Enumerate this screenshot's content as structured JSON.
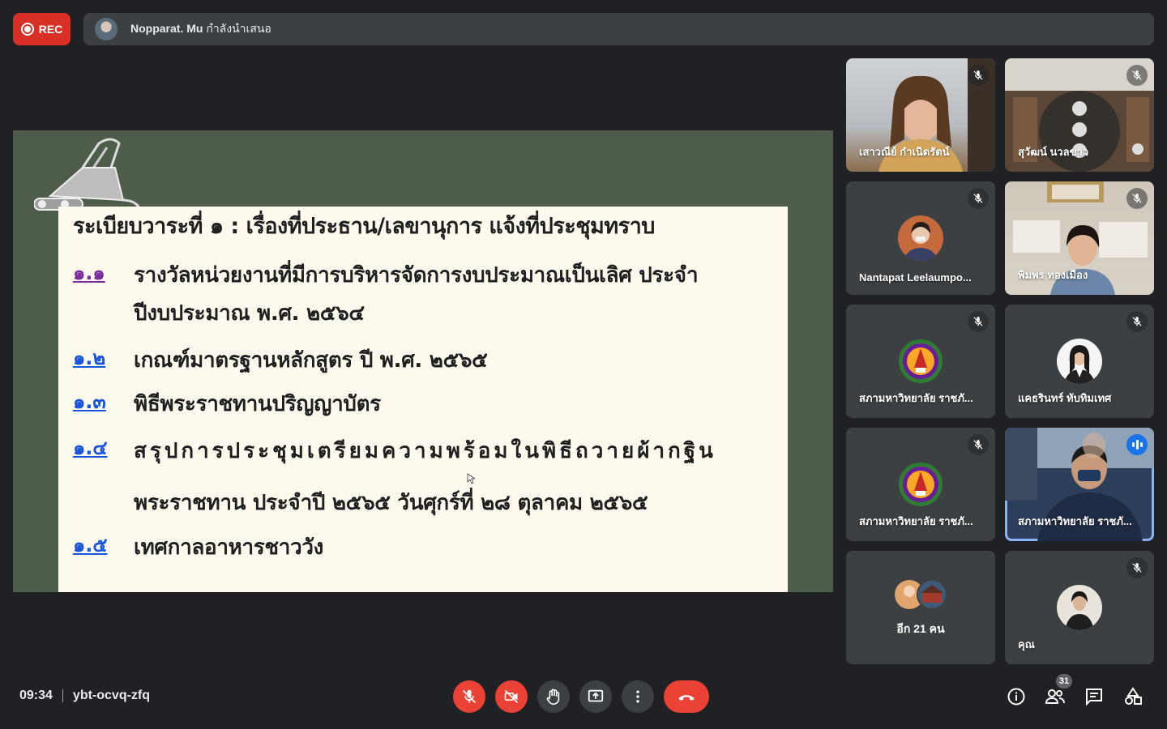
{
  "recording": {
    "label": "REC"
  },
  "presenter": {
    "name": "Nopparat. Mu",
    "status": " กำลังนำเสนอ"
  },
  "slide": {
    "title": "ระเบียบวาระที่ ๑ : เรื่องที่ประธาน/เลขานุการ แจ้งที่ประชุมทราบ",
    "items": [
      {
        "num": "๑.๑",
        "text": "รางวัลหน่วยงานที่มีการบริหารจัดการงบประมาณเป็นเลิศ ประจำปีงบประมาณ พ.ศ. ๒๕๖๔"
      },
      {
        "num": "๑.๒",
        "text": "เกณฑ์มาตรฐานหลักสูตร ปี พ.ศ. ๒๕๖๕"
      },
      {
        "num": "๑.๓",
        "text": "พิธีพระราชทานปริญญาบัตร"
      },
      {
        "num": "๑.๔",
        "text": "สรุปการประชุมเตรียมความพร้อมในพิธีถวายผ้ากฐิน",
        "text2": "พระราชทาน ประจำปี ๒๕๖๕ วันศุกร์ที่ ๒๘ ตุลาคม ๒๕๖๕"
      },
      {
        "num": "๑.๕",
        "text": "เทศกาลอาหารชาววัง"
      }
    ]
  },
  "participants": [
    {
      "name": "เสาวณีย์ กำเนิดรัตน์"
    },
    {
      "name": "สุวัฒน์ นวลขาว"
    },
    {
      "name": "Nantapat Leelaumpo..."
    },
    {
      "name": "พิมพร ทองเมือง"
    },
    {
      "name": "สภามหาวิทยาลัย ราชภั..."
    },
    {
      "name": "แคธรินทร์ ทับทิมเทศ"
    },
    {
      "name": "สภามหาวิทยาลัย ราชภั..."
    },
    {
      "name": "สภามหาวิทยาลัย ราชภั..."
    },
    {
      "name": "อีก 21 คน"
    },
    {
      "name": "คุณ"
    }
  ],
  "meeting": {
    "time": "09:34",
    "code": "ybt-ocvq-zfq",
    "participant_count": "31"
  }
}
